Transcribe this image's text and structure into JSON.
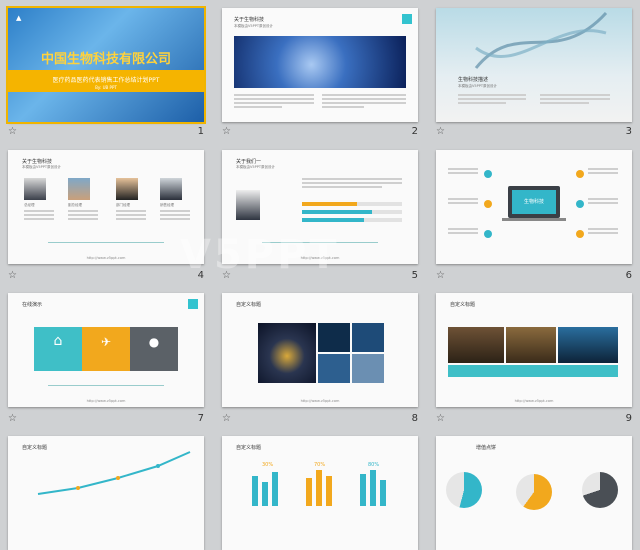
{
  "watermark": "V5PPT",
  "slides": [
    {
      "num": "1",
      "title": "中国生物科技有限公司",
      "subtitle": "医疗药品医药代表销售工作总结计划PPT",
      "author": "By: UB PPT"
    },
    {
      "num": "2",
      "title": "关于生物科技",
      "subtitle": "本模板由V5PPT原创设计"
    },
    {
      "num": "3",
      "title": "生物科技描述",
      "subtitle": "本模板由V5PPT原创设计"
    },
    {
      "num": "4",
      "title": "关于生物科技",
      "subtitle": "本模板由V5PPT原创设计",
      "members": [
        "总经理",
        "副总经理",
        "部门经理",
        "销售经理"
      ],
      "footer": "http://www.v5ppt.com"
    },
    {
      "num": "5",
      "title": "关于我们一",
      "subtitle": "本模板由V5PPT原创设计",
      "footer": "http://www.v5ppt.com"
    },
    {
      "num": "6",
      "center_label": "生物科技"
    },
    {
      "num": "7",
      "title": "在线演示",
      "footer": "http://www.v5ppt.com"
    },
    {
      "num": "8",
      "title": "自定义标题",
      "footer": "http://www.v5ppt.com"
    },
    {
      "num": "9",
      "title": "自定义标题",
      "footer": "http://www.v5ppt.com"
    },
    {
      "num": "",
      "title": "自定义标题"
    },
    {
      "num": "",
      "title": "自定义标题",
      "percents": [
        "30%",
        "70%",
        "80%"
      ]
    },
    {
      "num": "",
      "title": "增值点饼"
    }
  ]
}
